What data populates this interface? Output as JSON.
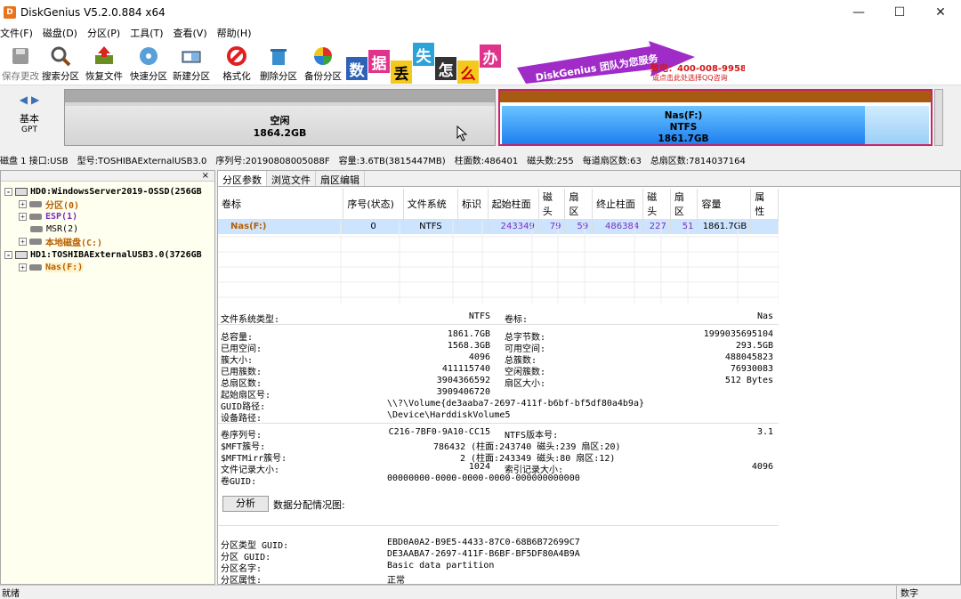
{
  "window": {
    "title": "DiskGenius V5.2.0.884 x64",
    "app_icon": "D"
  },
  "menu": [
    "文件(F)",
    "磁盘(D)",
    "分区(P)",
    "工具(T)",
    "查看(V)",
    "帮助(H)"
  ],
  "toolbar": {
    "save": "保存更改",
    "search": "搜索分区",
    "recover": "恢复文件",
    "quick": "快速分区",
    "newpart": "新建分区",
    "format": "格式化",
    "delete": "删除分区",
    "backup": "备份分区"
  },
  "banner": {
    "tiles": [
      "数",
      "据",
      "丢",
      "失",
      "怎",
      "么",
      "办"
    ],
    "slogan": "DiskGenius 团队为您服务",
    "phone": "致电：400-008-9958",
    "qq": "或点击此处选择QQ咨询"
  },
  "disk": {
    "type": "基本",
    "scheme": "GPT",
    "free_label": "空闲",
    "free_size": "1864.2GB",
    "ntfs_name": "Nas(F:)",
    "ntfs_fs": "NTFS",
    "ntfs_size": "1861.7GB"
  },
  "diskinfo": [
    "磁盘 1 接口:USB",
    "型号:TOSHIBAExternalUSB3.0",
    "序列号:20190808005088F",
    "容量:3.6TB(3815447MB)",
    "柱面数:486401",
    "磁头数:255",
    "每道扇区数:63",
    "总扇区数:7814037164"
  ],
  "tree": {
    "close": "×",
    "hd0": "HD0:WindowsServer2019-OSSD(256GB",
    "p0": "分区(0)",
    "esp": "ESP(1)",
    "msr": "MSR(2)",
    "local": "本地磁盘(C:)",
    "hd1": "HD1:TOSHIBAExternalUSB3.0(3726GB",
    "nas": "Nas(F:)"
  },
  "tabs": [
    "分区参数",
    "浏览文件",
    "扇区编辑"
  ],
  "table": {
    "headers": [
      "卷标",
      "序号(状态)",
      "文件系统",
      "标识",
      "起始柱面",
      "磁头",
      "扇区",
      "终止柱面",
      "磁头",
      "扇区",
      "容量",
      "属性"
    ],
    "row": [
      "Nas(F:)",
      "0",
      "NTFS",
      "",
      "243349",
      "79",
      "59",
      "486384",
      "227",
      "51",
      "1861.7GB",
      ""
    ]
  },
  "info": {
    "fs_type_k": "文件系统类型:",
    "fs_type_v": "NTFS",
    "vol_k": "卷标:",
    "vol_v": "Nas",
    "total_k": "总容量:",
    "total_v": "1861.7GB",
    "totalbytes_k": "总字节数:",
    "totalbytes_v": "1999035695104",
    "used_k": "已用空间:",
    "used_v": "1568.3GB",
    "avail_k": "可用空间:",
    "avail_v": "293.5GB",
    "cluster_k": "簇大小:",
    "cluster_v": "4096",
    "clusters_k": "总簇数:",
    "clusters_v": "488045823",
    "usedc_k": "已用簇数:",
    "usedc_v": "411115740",
    "freec_k": "空闲簇数:",
    "freec_v": "76930083",
    "sectors_k": "总扇区数:",
    "sectors_v": "3904366592",
    "secsize_k": "扇区大小:",
    "secsize_v": "512 Bytes",
    "start_k": "起始扇区号:",
    "start_v": "3909406720",
    "guidpath_k": "GUID路径:",
    "guidpath_v": "\\\\?\\Volume{de3aaba7-2697-411f-b6bf-bf5df80a4b9a}",
    "devpath_k": "设备路径:",
    "devpath_v": "\\Device\\HarddiskVolume5",
    "serial_k": "卷序列号:",
    "serial_v": "C216-7BF0-9A10-CC15",
    "ntfsver_k": "NTFS版本号:",
    "ntfsver_v": "3.1",
    "mft_k": "$MFT簇号:",
    "mft_v": "786432 (柱面:243740 磁头:239 扇区:20)",
    "mftm_k": "$MFTMirr簇号:",
    "mftm_v": "2 (柱面:243349 磁头:80 扇区:12)",
    "frs_k": "文件记录大小:",
    "frs_v": "1024",
    "idx_k": "索引记录大小:",
    "idx_v": "4096",
    "volguid_k": "卷GUID:",
    "volguid_v": "00000000-0000-0000-0000-000000000000",
    "analyze": "分析",
    "dist": "数据分配情况图:",
    "ptype_k": "分区类型 GUID:",
    "ptype_v": "EBD0A0A2-B9E5-4433-87C0-68B6B72699C7",
    "pguid_k": "分区 GUID:",
    "pguid_v": "DE3AABA7-2697-411F-B6BF-BF5DF80A4B9A",
    "pname_k": "分区名字:",
    "pname_v": "Basic data partition",
    "pattr_k": "分区属性:",
    "pattr_v": "正常"
  },
  "status": {
    "left": "就绪",
    "right": "数字"
  }
}
